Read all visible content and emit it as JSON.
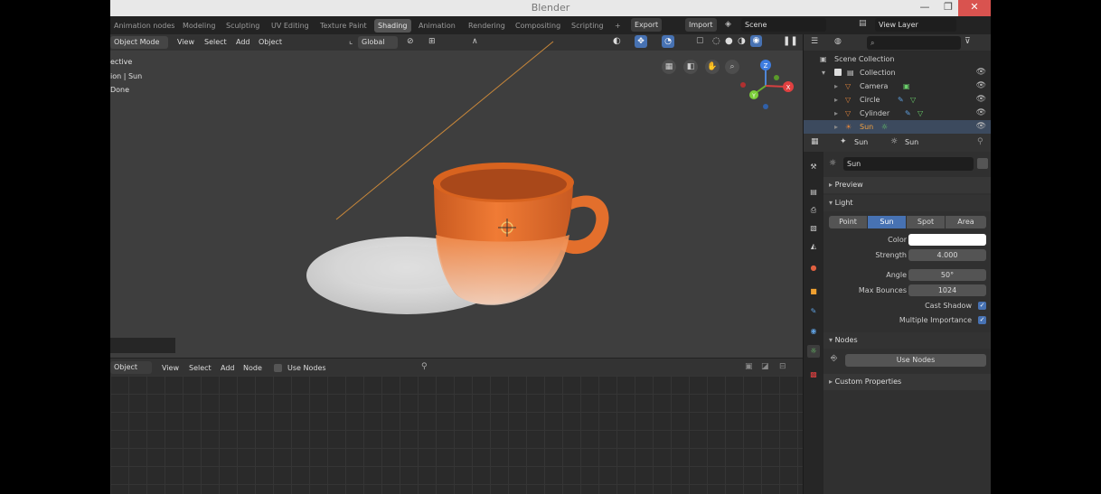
{
  "window": {
    "title": "Blender",
    "minimize": "—",
    "maximize": "❐",
    "close": "✕"
  },
  "tabs": [
    {
      "label": "Animation nodes"
    },
    {
      "label": "Modeling"
    },
    {
      "label": "Sculpting"
    },
    {
      "label": "UV Editing"
    },
    {
      "label": "Texture Paint"
    },
    {
      "label": "Shading"
    },
    {
      "label": "Animation"
    },
    {
      "label": "Rendering"
    },
    {
      "label": "Compositing"
    },
    {
      "label": "Scripting"
    },
    {
      "label": "+"
    }
  ],
  "topbar": {
    "export": "Export",
    "import": "Import",
    "scene": "Scene",
    "view_layer": "View Layer"
  },
  "viewport": {
    "mode": "Object Mode",
    "menus": [
      "View",
      "Select",
      "Add",
      "Object"
    ],
    "orientation": "Global",
    "overlay_lines": [
      "ective",
      "ion | Sun",
      "Done"
    ]
  },
  "gizmo": {
    "x": "X",
    "y": "Y",
    "z": "Z"
  },
  "nodes": {
    "object": "Object",
    "menus": [
      "View",
      "Select",
      "Add",
      "Node"
    ],
    "use_nodes": "Use Nodes"
  },
  "outliner": {
    "search_placeholder": "",
    "scene_collection": "Scene Collection",
    "collection": "Collection",
    "items": [
      {
        "label": "Camera"
      },
      {
        "label": "Circle"
      },
      {
        "label": "Cylinder"
      },
      {
        "label": "Sun"
      }
    ]
  },
  "properties": {
    "object": "Sun",
    "data": "Sun",
    "datablock": "Sun",
    "preview": "Preview",
    "light": "Light",
    "light_types": [
      "Point",
      "Sun",
      "Spot",
      "Area"
    ],
    "color_label": "Color",
    "color": "#ffffff",
    "strength_label": "Strength",
    "strength": "4.000",
    "angle_label": "Angle",
    "angle": "50°",
    "max_bounces_label": "Max Bounces",
    "max_bounces": "1024",
    "cast_shadow": "Cast Shadow",
    "multiple_importance": "Multiple Importance",
    "nodes": "Nodes",
    "use_nodes": "Use Nodes",
    "custom_properties": "Custom Properties"
  },
  "colors": {
    "accent": "#4772b3",
    "cup": "#e8702e",
    "saucer": "#d9d9d9",
    "light_line": "#c8873a"
  }
}
